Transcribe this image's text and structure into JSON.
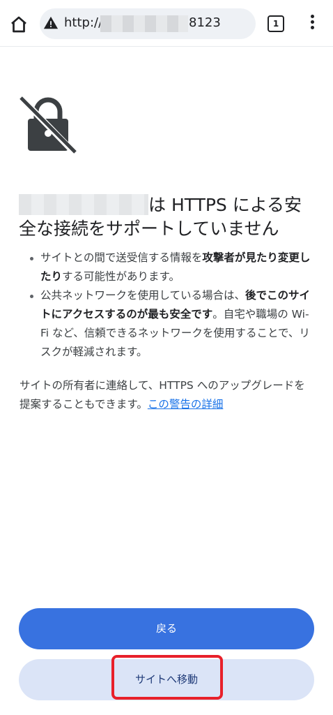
{
  "browser": {
    "url_prefix": "http://",
    "url_suffix": "8123",
    "tab_count": "1"
  },
  "page": {
    "title_part1": "は HTTPS による安",
    "title_part2": "全な接続をサポートしていません",
    "bullet1_pre": "サイトとの間で送受信する情報を",
    "bullet1_bold": "攻撃者が見たり変更したり",
    "bullet1_post": "する可能性があります。",
    "bullet2_pre": "公共ネットワークを使用している場合は、",
    "bullet2_bold": "後でこのサイトにアクセスするのが最も安全です",
    "bullet2_post": "。自宅や職場の Wi-Fi など、信頼できるネットワークを使用することで、リスクが軽減されます。",
    "para_text": "サイトの所有者に連絡して、HTTPS へのアップグレードを提案することもできます。",
    "para_link": "この警告の詳細"
  },
  "buttons": {
    "back": "戻る",
    "proceed": "サイトへ移動"
  },
  "colors": {
    "primary": "#3872e0",
    "secondary_bg": "#dbe4f7",
    "highlight": "#e8202a",
    "link": "#1a73e8"
  }
}
